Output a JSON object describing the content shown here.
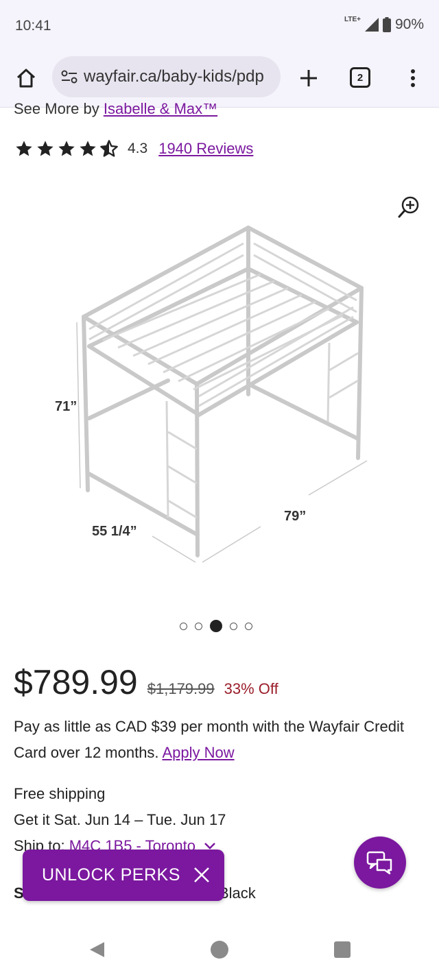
{
  "status": {
    "time": "10:41",
    "network": "LTE+",
    "battery": "90%"
  },
  "browser": {
    "url": "wayfair.ca/baby-kids/pdp",
    "tab_count": "2"
  },
  "product": {
    "see_more_prefix": "See More by ",
    "brand_link": "Isabelle & Max™",
    "rating": "4.3",
    "rating_value": 4.3,
    "rating_max": 5,
    "reviews_link": "1940 Reviews",
    "dimensions": {
      "height": "71”",
      "width": "55 1/4”",
      "length": "79”"
    },
    "carousel": {
      "count": 5,
      "active_index": 2
    },
    "price": "$789.99",
    "old_price": "$1,179.99",
    "discount": "33% Off",
    "credit_text": "Pay as little as CAD $39 per month with the Wayfair Credit Card over 12 months. ",
    "apply_link": "Apply Now",
    "shipping_title": "Free shipping",
    "delivery": "Get it Sat. Jun 14 – Tue. Jun 17",
    "ship_to_prefix": "Ship to: ",
    "ship_to_link": "M4C 1B5 - Toronto",
    "color_prefix": "S",
    "color_value": "Black"
  },
  "overlays": {
    "perks_label": "UNLOCK PERKS"
  },
  "colors": {
    "brand": "#7b189f",
    "discount": "#9a1d2a"
  }
}
